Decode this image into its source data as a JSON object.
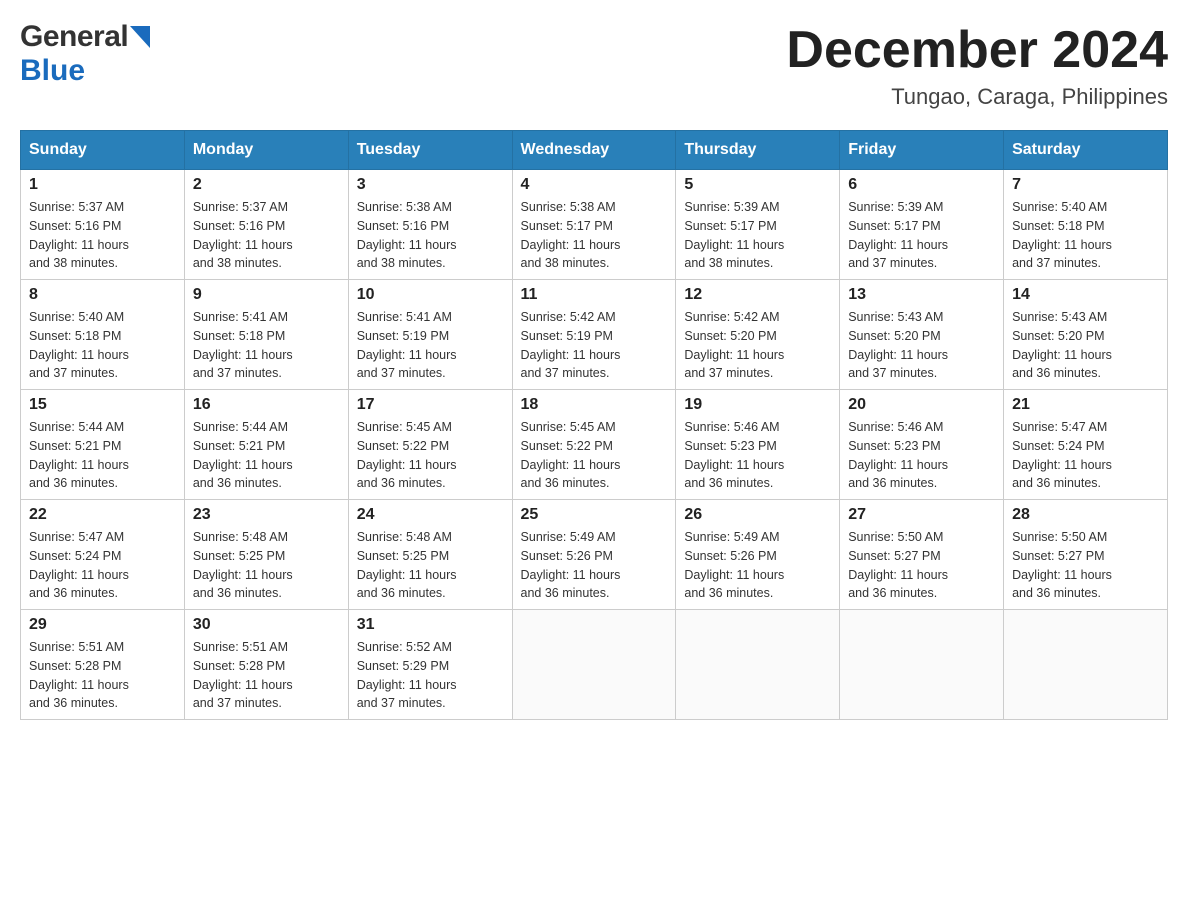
{
  "header": {
    "logo_general": "General",
    "logo_blue": "Blue",
    "month": "December 2024",
    "location": "Tungao, Caraga, Philippines"
  },
  "weekdays": [
    "Sunday",
    "Monday",
    "Tuesday",
    "Wednesday",
    "Thursday",
    "Friday",
    "Saturday"
  ],
  "weeks": [
    [
      {
        "day": "1",
        "info": "Sunrise: 5:37 AM\nSunset: 5:16 PM\nDaylight: 11 hours\nand 38 minutes."
      },
      {
        "day": "2",
        "info": "Sunrise: 5:37 AM\nSunset: 5:16 PM\nDaylight: 11 hours\nand 38 minutes."
      },
      {
        "day": "3",
        "info": "Sunrise: 5:38 AM\nSunset: 5:16 PM\nDaylight: 11 hours\nand 38 minutes."
      },
      {
        "day": "4",
        "info": "Sunrise: 5:38 AM\nSunset: 5:17 PM\nDaylight: 11 hours\nand 38 minutes."
      },
      {
        "day": "5",
        "info": "Sunrise: 5:39 AM\nSunset: 5:17 PM\nDaylight: 11 hours\nand 38 minutes."
      },
      {
        "day": "6",
        "info": "Sunrise: 5:39 AM\nSunset: 5:17 PM\nDaylight: 11 hours\nand 37 minutes."
      },
      {
        "day": "7",
        "info": "Sunrise: 5:40 AM\nSunset: 5:18 PM\nDaylight: 11 hours\nand 37 minutes."
      }
    ],
    [
      {
        "day": "8",
        "info": "Sunrise: 5:40 AM\nSunset: 5:18 PM\nDaylight: 11 hours\nand 37 minutes."
      },
      {
        "day": "9",
        "info": "Sunrise: 5:41 AM\nSunset: 5:18 PM\nDaylight: 11 hours\nand 37 minutes."
      },
      {
        "day": "10",
        "info": "Sunrise: 5:41 AM\nSunset: 5:19 PM\nDaylight: 11 hours\nand 37 minutes."
      },
      {
        "day": "11",
        "info": "Sunrise: 5:42 AM\nSunset: 5:19 PM\nDaylight: 11 hours\nand 37 minutes."
      },
      {
        "day": "12",
        "info": "Sunrise: 5:42 AM\nSunset: 5:20 PM\nDaylight: 11 hours\nand 37 minutes."
      },
      {
        "day": "13",
        "info": "Sunrise: 5:43 AM\nSunset: 5:20 PM\nDaylight: 11 hours\nand 37 minutes."
      },
      {
        "day": "14",
        "info": "Sunrise: 5:43 AM\nSunset: 5:20 PM\nDaylight: 11 hours\nand 36 minutes."
      }
    ],
    [
      {
        "day": "15",
        "info": "Sunrise: 5:44 AM\nSunset: 5:21 PM\nDaylight: 11 hours\nand 36 minutes."
      },
      {
        "day": "16",
        "info": "Sunrise: 5:44 AM\nSunset: 5:21 PM\nDaylight: 11 hours\nand 36 minutes."
      },
      {
        "day": "17",
        "info": "Sunrise: 5:45 AM\nSunset: 5:22 PM\nDaylight: 11 hours\nand 36 minutes."
      },
      {
        "day": "18",
        "info": "Sunrise: 5:45 AM\nSunset: 5:22 PM\nDaylight: 11 hours\nand 36 minutes."
      },
      {
        "day": "19",
        "info": "Sunrise: 5:46 AM\nSunset: 5:23 PM\nDaylight: 11 hours\nand 36 minutes."
      },
      {
        "day": "20",
        "info": "Sunrise: 5:46 AM\nSunset: 5:23 PM\nDaylight: 11 hours\nand 36 minutes."
      },
      {
        "day": "21",
        "info": "Sunrise: 5:47 AM\nSunset: 5:24 PM\nDaylight: 11 hours\nand 36 minutes."
      }
    ],
    [
      {
        "day": "22",
        "info": "Sunrise: 5:47 AM\nSunset: 5:24 PM\nDaylight: 11 hours\nand 36 minutes."
      },
      {
        "day": "23",
        "info": "Sunrise: 5:48 AM\nSunset: 5:25 PM\nDaylight: 11 hours\nand 36 minutes."
      },
      {
        "day": "24",
        "info": "Sunrise: 5:48 AM\nSunset: 5:25 PM\nDaylight: 11 hours\nand 36 minutes."
      },
      {
        "day": "25",
        "info": "Sunrise: 5:49 AM\nSunset: 5:26 PM\nDaylight: 11 hours\nand 36 minutes."
      },
      {
        "day": "26",
        "info": "Sunrise: 5:49 AM\nSunset: 5:26 PM\nDaylight: 11 hours\nand 36 minutes."
      },
      {
        "day": "27",
        "info": "Sunrise: 5:50 AM\nSunset: 5:27 PM\nDaylight: 11 hours\nand 36 minutes."
      },
      {
        "day": "28",
        "info": "Sunrise: 5:50 AM\nSunset: 5:27 PM\nDaylight: 11 hours\nand 36 minutes."
      }
    ],
    [
      {
        "day": "29",
        "info": "Sunrise: 5:51 AM\nSunset: 5:28 PM\nDaylight: 11 hours\nand 36 minutes."
      },
      {
        "day": "30",
        "info": "Sunrise: 5:51 AM\nSunset: 5:28 PM\nDaylight: 11 hours\nand 37 minutes."
      },
      {
        "day": "31",
        "info": "Sunrise: 5:52 AM\nSunset: 5:29 PM\nDaylight: 11 hours\nand 37 minutes."
      },
      {
        "day": "",
        "info": ""
      },
      {
        "day": "",
        "info": ""
      },
      {
        "day": "",
        "info": ""
      },
      {
        "day": "",
        "info": ""
      }
    ]
  ]
}
